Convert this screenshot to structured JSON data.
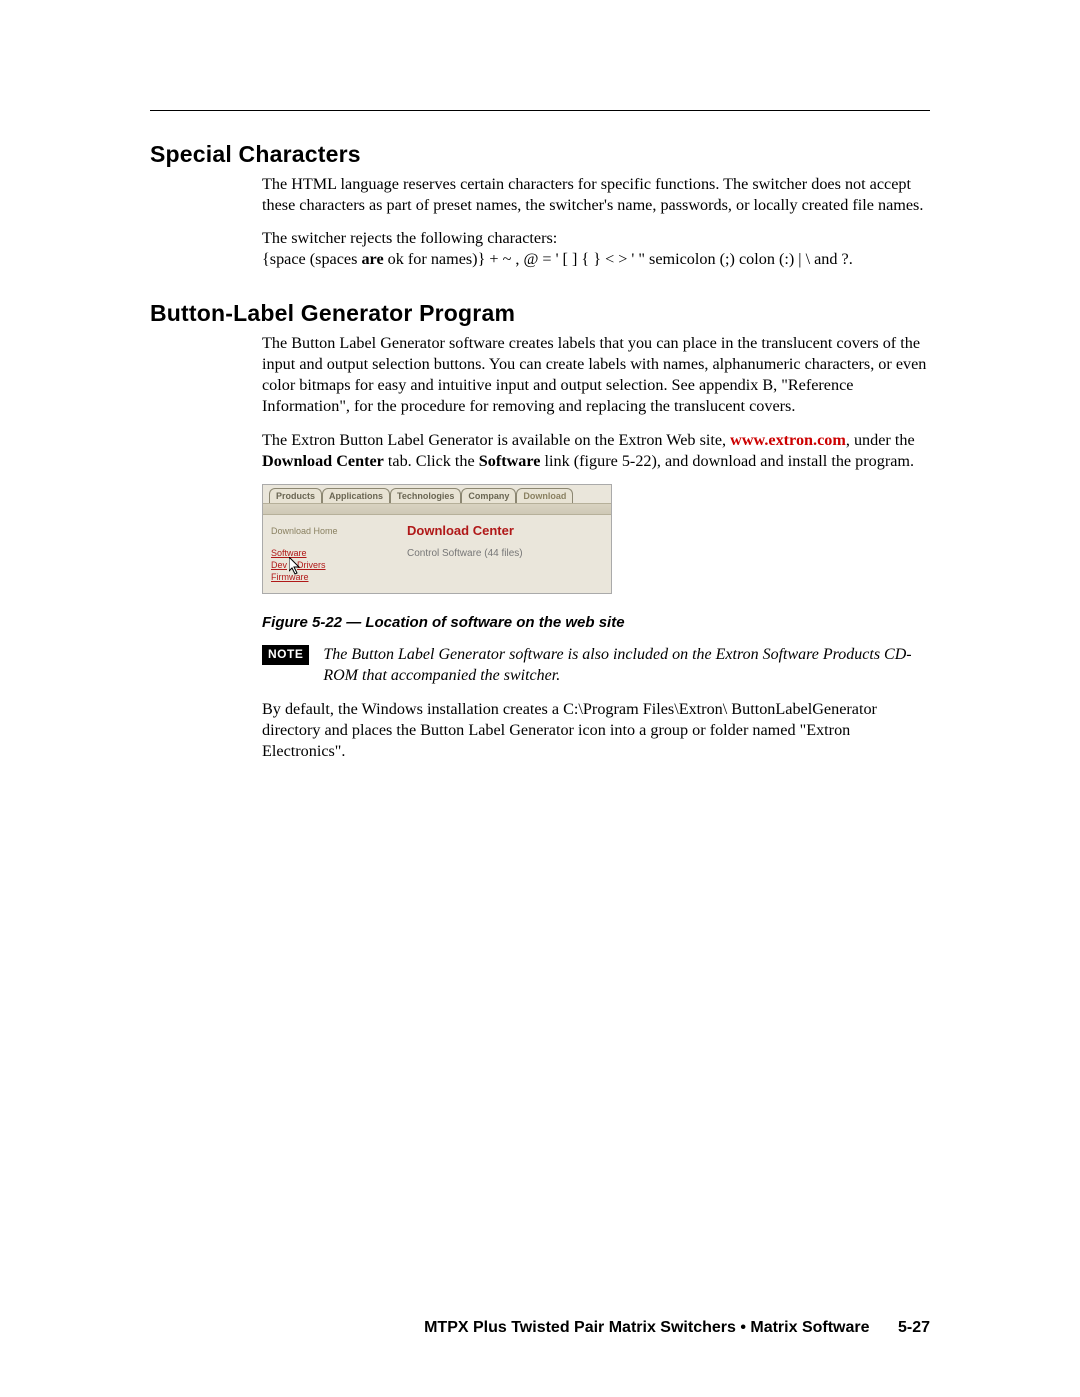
{
  "section1": {
    "title": "Special Characters",
    "p1": "The HTML language reserves certain characters for specific functions.  The switcher does not accept these characters as part of preset names, the switcher's name, passwords, or locally created file names.",
    "p2a": "The switcher rejects the following characters:",
    "p2b_pre": "{space (spaces ",
    "p2b_bold": "are",
    "p2b_post": " ok for names)}  +  ~  ,  @  =  '  [  ]  {  }  <  >  '  \"   semicolon (;)  colon (:)   |   \\   and ?."
  },
  "section2": {
    "title": "Button-Label Generator Program",
    "p1": "The Button Label Generator software creates labels that you can place in the translucent covers of the input and output selection buttons.  You can create labels with names, alphanumeric characters, or even color bitmaps for easy and intuitive input and output selection.  See appendix B, \"Reference Information\", for the procedure for removing and replacing the translucent covers.",
    "p2_pre": "The Extron Button Label Generator is available on the Extron Web site, ",
    "p2_link": "www.extron.com",
    "p2_mid1": ", under the ",
    "p2_b1": "Download Center",
    "p2_mid2": " tab.  Click the ",
    "p2_b2": "Software",
    "p2_post": " link (figure 5-22), and download and install the program.",
    "p3": "By default, the Windows installation creates a C:\\Program Files\\Extron\\ ButtonLabelGenerator directory and places the Button Label Generator icon into a group or folder named \"Extron Electronics\"."
  },
  "screenshot": {
    "tabs": [
      "Products",
      "Applications",
      "Technologies",
      "Company",
      "Download"
    ],
    "left_home": "Download Home",
    "left_links": [
      "Software",
      "Dev",
      "Drivers",
      "Firmware"
    ],
    "right_heading": "Download Center",
    "right_text": "Control Software (44 files)"
  },
  "figcaption": "Figure 5-22 — Location of software on the web site",
  "note": {
    "badge": "NOTE",
    "text": "The Button Label Generator software is also included on the Extron Software Products CD-ROM that accompanied the switcher."
  },
  "footer": {
    "text": "MTPX Plus Twisted Pair Matrix Switchers • Matrix Software",
    "page": "5-27"
  }
}
